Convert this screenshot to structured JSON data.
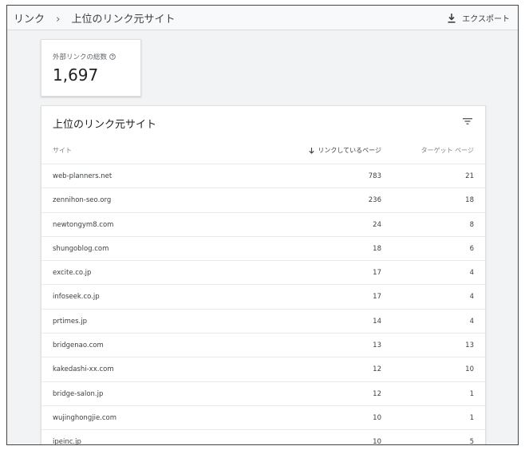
{
  "breadcrumb": {
    "root": "リンク",
    "separator": "›",
    "current": "上位のリンク元サイト"
  },
  "toolbar": {
    "export_label": "エクスポート",
    "export_icon": "download-icon"
  },
  "metric": {
    "label": "外部リンクの総数",
    "value": "1,697",
    "help_icon": "help-circle-icon"
  },
  "table": {
    "title": "上位のリンク元サイト",
    "filter_icon": "filter-icon",
    "columns": {
      "site": "サイト",
      "linking_pages": "リンクしているページ",
      "target_pages": "ターゲット ページ"
    },
    "sort": {
      "column": "linking_pages",
      "direction": "descending",
      "icon": "arrow-down-icon"
    },
    "rows": [
      {
        "site": "web-planners.net",
        "linking": "783",
        "target": "21"
      },
      {
        "site": "zennihon-seo.org",
        "linking": "236",
        "target": "18"
      },
      {
        "site": "newtongym8.com",
        "linking": "24",
        "target": "8"
      },
      {
        "site": "shungoblog.com",
        "linking": "18",
        "target": "6"
      },
      {
        "site": "excite.co.jp",
        "linking": "17",
        "target": "4"
      },
      {
        "site": "infoseek.co.jp",
        "linking": "17",
        "target": "4"
      },
      {
        "site": "prtimes.jp",
        "linking": "14",
        "target": "4"
      },
      {
        "site": "bridgenao.com",
        "linking": "13",
        "target": "13"
      },
      {
        "site": "kakedashi-xx.com",
        "linking": "12",
        "target": "10"
      },
      {
        "site": "bridge-salon.jp",
        "linking": "12",
        "target": "1"
      },
      {
        "site": "wujinghongjie.com",
        "linking": "10",
        "target": "1"
      },
      {
        "site": "ipeinc.jp",
        "linking": "10",
        "target": "5"
      }
    ]
  }
}
